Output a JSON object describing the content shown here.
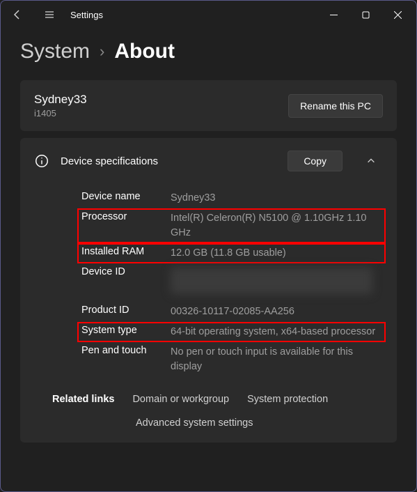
{
  "titlebar": {
    "app": "Settings"
  },
  "breadcrumb": {
    "parent": "System",
    "sep": "›",
    "current": "About"
  },
  "pc": {
    "name": "Sydney33",
    "model": "i1405",
    "rename_btn": "Rename this PC"
  },
  "specs": {
    "title": "Device specifications",
    "copy_btn": "Copy",
    "rows": {
      "device_name": {
        "label": "Device name",
        "value": "Sydney33"
      },
      "processor": {
        "label": "Processor",
        "value": "Intel(R) Celeron(R) N5100 @ 1.10GHz 1.10 GHz"
      },
      "ram": {
        "label": "Installed RAM",
        "value": "12.0 GB (11.8 GB usable)"
      },
      "device_id": {
        "label": "Device ID",
        "value": ""
      },
      "product_id": {
        "label": "Product ID",
        "value": "00326-10117-02085-AA256"
      },
      "system_type": {
        "label": "System type",
        "value": "64-bit operating system, x64-based processor"
      },
      "pen_touch": {
        "label": "Pen and touch",
        "value": "No pen or touch input is available for this display"
      }
    }
  },
  "related": {
    "label": "Related links",
    "links": {
      "domain": "Domain or workgroup",
      "protection": "System protection",
      "advanced": "Advanced system settings"
    }
  }
}
